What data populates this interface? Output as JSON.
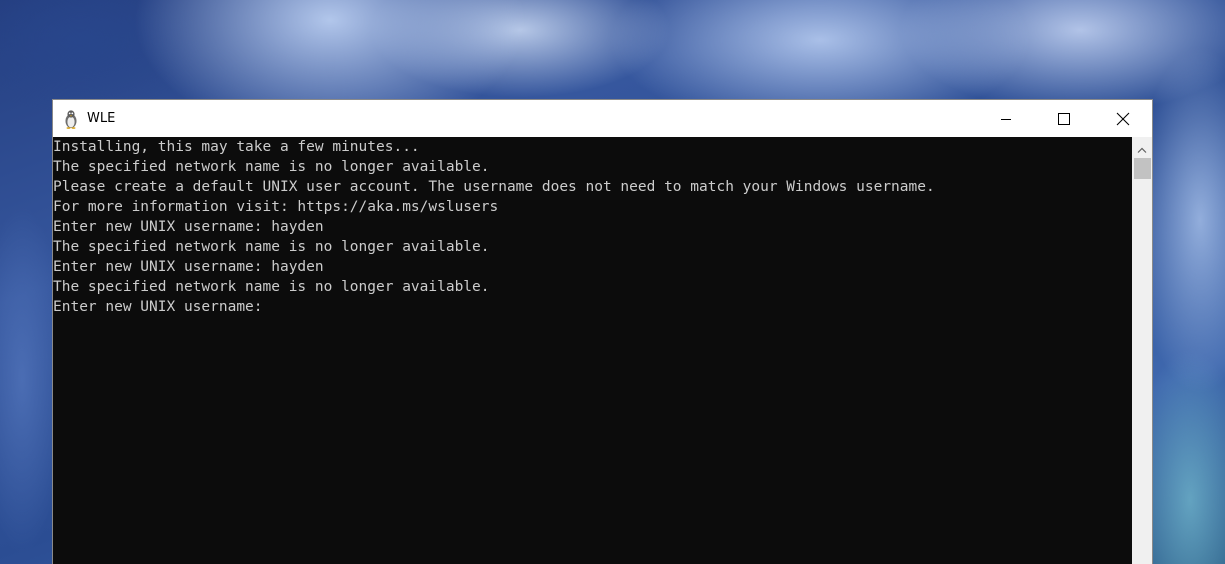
{
  "window": {
    "title": "WLE",
    "app_icon": "penguin-icon",
    "controls": {
      "minimize": "minimize-icon",
      "maximize": "maximize-icon",
      "close": "close-icon"
    }
  },
  "console": {
    "lines": [
      "Installing, this may take a few minutes...",
      "The specified network name is no longer available.",
      "Please create a default UNIX user account. The username does not need to match your Windows username.",
      "For more information visit: https://aka.ms/wslusers",
      "Enter new UNIX username: hayden",
      "The specified network name is no longer available.",
      "Enter new UNIX username: hayden",
      "The specified network name is no longer available.",
      "Enter new UNIX username: "
    ]
  },
  "colors": {
    "console_background": "#0c0c0c",
    "console_text": "#cccccc",
    "titlebar_background": "#ffffff"
  }
}
